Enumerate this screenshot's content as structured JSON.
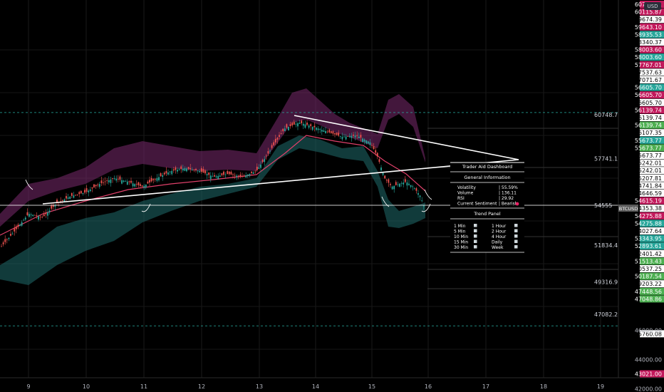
{
  "chart_data": {
    "type": "candlestick",
    "x_ticks": [
      "9",
      "10",
      "11",
      "12",
      "13",
      "14",
      "15",
      "16",
      "17",
      "18",
      "19"
    ],
    "currency_badge": "USD",
    "symbol_badge": "BTCUSD",
    "y_ticks_plain": [
      "46000.00",
      "44000.00",
      "42000.00"
    ],
    "price_tags": [
      {
        "label": "60750.41",
        "price": 60750.41,
        "color": "#c2185b"
      },
      {
        "label": "60115.87",
        "price": 60115.87,
        "color": "#c2185b"
      },
      {
        "label": "59674.39",
        "price": 59674.39,
        "color": "#ffffff"
      },
      {
        "label": "59643.10",
        "price": 59643.1,
        "color": "#c2185b"
      },
      {
        "label": "58935.53",
        "price": 58935.53,
        "color": "#26a69a"
      },
      {
        "label": "58340.37",
        "price": 58340.37,
        "color": "#ffffff"
      },
      {
        "label": "58003.60",
        "price": 58003.6,
        "color": "#c2185b"
      },
      {
        "label": "58003.60",
        "price": 57750.0,
        "color": "#26a69a"
      },
      {
        "label": "57767.01",
        "price": 57767.01,
        "color": "#c2185b"
      },
      {
        "label": "57537.63",
        "price": 57537.63,
        "color": "#ffffff"
      },
      {
        "label": "57071.67",
        "price": 57071.67,
        "color": "#ffffff"
      },
      {
        "label": "56605.70",
        "price": 56605.7,
        "color": "#26a69a"
      },
      {
        "label": "56605.70",
        "price": 56450.0,
        "color": "#c2185b"
      },
      {
        "label": "56605.70",
        "price": 56300.0,
        "color": "#ffffff"
      },
      {
        "label": "56139.74",
        "price": 56139.74,
        "color": "#c2185b"
      },
      {
        "label": "56139.74",
        "price": 55990.0,
        "color": "#ffffff"
      },
      {
        "label": "56139.74",
        "price": 55840.0,
        "color": "#4caf50"
      },
      {
        "label": "56107.35",
        "price": 55690.0,
        "color": "#ffffff"
      },
      {
        "label": "55673.77",
        "price": 55540.0,
        "color": "#26a69a"
      },
      {
        "label": "55673.77",
        "price": 55390.0,
        "color": "#4caf50"
      },
      {
        "label": "55673.77",
        "price": 55240.0,
        "color": "#ffffff"
      },
      {
        "label": "55242.01",
        "price": 55090.0,
        "color": "#ffffff"
      },
      {
        "label": "55242.01",
        "price": 54940.0,
        "color": "#ffffff"
      },
      {
        "label": "55207.81",
        "price": 54790.0,
        "color": "#ffffff"
      },
      {
        "label": "54741.84",
        "price": 54640.0,
        "color": "#ffffff"
      },
      {
        "label": "54646.59",
        "price": 54490.0,
        "color": "#ffffff"
      },
      {
        "label": "54615.19",
        "price": 54340.0,
        "color": "#c2185b"
      },
      {
        "label": "54353.38",
        "price": 54190.0,
        "color": "#ffffff"
      },
      {
        "label": "54275.88",
        "price": 54040.0,
        "color": "#c2185b"
      },
      {
        "label": "54275.88",
        "price": 53890.0,
        "color": "#26a69a"
      },
      {
        "label": "54027.64",
        "price": 53740.0,
        "color": "#ffffff"
      },
      {
        "label": "53343.95",
        "price": 53590.0,
        "color": "#26a69a"
      },
      {
        "label": "52893.61",
        "price": 53440.0,
        "color": "#26a69a"
      },
      {
        "label": "52401.42",
        "price": 53290.0,
        "color": "#ffffff"
      },
      {
        "label": "51513.43",
        "price": 53140.0,
        "color": "#4caf50"
      },
      {
        "label": "50537.25",
        "price": 52990.0,
        "color": "#ffffff"
      },
      {
        "label": "50187.54",
        "price": 52840.0,
        "color": "#4caf50"
      },
      {
        "label": "49203.22",
        "price": 52690.0,
        "color": "#ffffff"
      },
      {
        "label": "47448.56",
        "price": 52540.0,
        "color": "#4caf50"
      },
      {
        "label": "47048.86",
        "price": 52390.0,
        "color": "#4caf50"
      },
      {
        "label": "45760.08",
        "price": 45760.08,
        "color": "#ffffff"
      },
      {
        "label": "43021.00",
        "price": 43021.0,
        "color": "#c2185b"
      }
    ],
    "current_price_tag": "BTCUSD",
    "level_labels": [
      {
        "label": "60748.78",
        "y_price": 60748.78
      },
      {
        "label": "57741.11",
        "y_price": 57741.11
      },
      {
        "label": "54555",
        "y_price": 54555
      },
      {
        "label": "51834.49",
        "y_price": 51834.49
      },
      {
        "label": "49316.98",
        "y_price": 49316.98
      },
      {
        "label": "47082.29",
        "y_price": 47082.29
      }
    ],
    "horizontal_lines": [
      {
        "price": 60900,
        "style": "dashed",
        "color": "#26a69a"
      },
      {
        "price": 54555,
        "style": "solid",
        "color": "#ffffff"
      },
      {
        "price": 46300,
        "style": "dashed",
        "color": "#26a69a"
      }
    ],
    "grid": true
  },
  "dashboard": {
    "title": "Trader Aid Dashboard",
    "section_general": "General Information",
    "rows": [
      {
        "label": "Volatility",
        "value": "55.59%"
      },
      {
        "label": "Volume",
        "value": "136.11"
      },
      {
        "label": "RSI",
        "value": "29.92"
      },
      {
        "label": "Current Sentiment",
        "value": "Bearish"
      }
    ],
    "trend_title": "Trend Panel",
    "trend_left": [
      "1 Min",
      "5 Min",
      "10 Min",
      "15 Min",
      "30 Min"
    ],
    "trend_right": [
      "1 Hour",
      "2 Hour",
      "4 Hour",
      "Daily",
      "Week"
    ]
  }
}
